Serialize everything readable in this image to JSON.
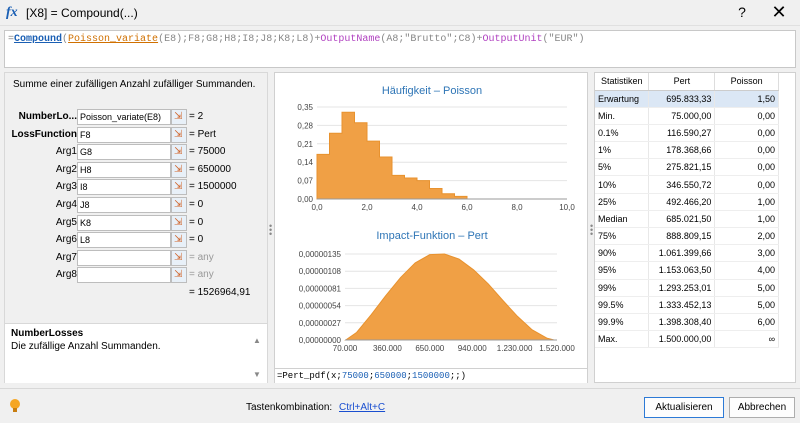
{
  "window": {
    "title": "[X8] = Compound(...)",
    "help": "?",
    "close": "✕"
  },
  "formula": {
    "full": "=Compound(Poisson_variate(E8);F8;G8;H8;I8;J8;K8;L8)+OutputName(A8;\"Brutto\";C8)+OutputUnit(\"EUR\")"
  },
  "left": {
    "summary": "Summe einer zufälligen Anzahl zufälliger Summanden.",
    "args": [
      {
        "label": "NumberLo...",
        "input": "Poisson_variate(E8)",
        "value": "= 2",
        "bold": true
      },
      {
        "label": "LossFunction",
        "input": "F8",
        "value": "= Pert",
        "bold": true
      },
      {
        "label": "Arg1",
        "input": "G8",
        "value": "= 75000"
      },
      {
        "label": "Arg2",
        "input": "H8",
        "value": "= 650000"
      },
      {
        "label": "Arg3",
        "input": "I8",
        "value": "= 1500000"
      },
      {
        "label": "Arg4",
        "input": "J8",
        "value": "= 0"
      },
      {
        "label": "Arg5",
        "input": "K8",
        "value": "= 0"
      },
      {
        "label": "Arg6",
        "input": "L8",
        "value": "= 0"
      },
      {
        "label": "Arg7",
        "input": "",
        "value": "= any",
        "dim": true
      },
      {
        "label": "Arg8",
        "input": "",
        "value": "= any",
        "dim": true
      }
    ],
    "result": "= 1526964,91",
    "desc_title": "NumberLosses",
    "desc_text": "Die zufällige Anzahl Summanden."
  },
  "charts": {
    "pdf_formula": "=Pert_pdf(x;75000;650000;1500000;;)"
  },
  "chart_data": [
    {
      "type": "area",
      "title": "Häufigkeit – Poisson",
      "x": [
        0,
        0.5,
        1.0,
        1.5,
        2.0,
        2.5,
        3.0,
        3.5,
        4.0,
        4.5,
        5.0,
        5.5,
        6.0
      ],
      "y": [
        0.17,
        0.25,
        0.33,
        0.29,
        0.22,
        0.16,
        0.09,
        0.08,
        0.07,
        0.04,
        0.02,
        0.01,
        0.0
      ],
      "xlim": [
        0,
        10
      ],
      "ylim": [
        0,
        0.35
      ],
      "xticks": [
        "0,0",
        "2,0",
        "4,0",
        "6,0",
        "8,0",
        "10,0"
      ],
      "yticks": [
        "0,00",
        "0,07",
        "0,14",
        "0,21",
        "0,28",
        "0,35"
      ],
      "color": "#f0a045"
    },
    {
      "type": "area",
      "title": "Impact-Funktion – Pert",
      "x": [
        75000,
        150000,
        250000,
        350000,
        450000,
        550000,
        650000,
        750000,
        850000,
        950000,
        1050000,
        1150000,
        1250000,
        1350000,
        1450000,
        1500000
      ],
      "y": [
        0,
        1.2e-07,
        4e-07,
        7e-07,
        9.8e-07,
        1.21e-06,
        1.34e-06,
        1.35e-06,
        1.27e-06,
        1.1e-06,
        8.8e-07,
        6.2e-07,
        3.7e-07,
        1.6e-07,
        3e-08,
        0
      ],
      "xlim": [
        70000,
        1520000
      ],
      "ylim": [
        0,
        1.35e-06
      ],
      "xticks": [
        "70.000",
        "360.000",
        "650.000",
        "940.000",
        "1.230.000",
        "1.520.000"
      ],
      "yticks": [
        "0,00000000",
        "0,00000027",
        "0,00000054",
        "0,00000081",
        "0,00000108",
        "0,00000135"
      ],
      "color": "#f0a045"
    }
  ],
  "stats": {
    "headers": [
      "Statistiken",
      "Pert",
      "Poisson"
    ],
    "rows": [
      [
        "Erwartung",
        "695.833,33",
        "1,50"
      ],
      [
        "Min.",
        "75.000,00",
        "0,00"
      ],
      [
        "0.1%",
        "116.590,27",
        "0,00"
      ],
      [
        "1%",
        "178.368,66",
        "0,00"
      ],
      [
        "5%",
        "275.821,15",
        "0,00"
      ],
      [
        "10%",
        "346.550,72",
        "0,00"
      ],
      [
        "25%",
        "492.466,20",
        "1,00"
      ],
      [
        "Median",
        "685.021,50",
        "1,00"
      ],
      [
        "75%",
        "888.809,15",
        "2,00"
      ],
      [
        "90%",
        "1.061.399,66",
        "3,00"
      ],
      [
        "95%",
        "1.153.063,50",
        "4,00"
      ],
      [
        "99%",
        "1.293.253,01",
        "5,00"
      ],
      [
        "99.5%",
        "1.333.452,13",
        "5,00"
      ],
      [
        "99.9%",
        "1.398.308,40",
        "6,00"
      ],
      [
        "Max.",
        "1.500.000,00",
        "∞"
      ]
    ]
  },
  "bottom": {
    "shortcut_label": "Tastenkombination:",
    "shortcut_link": "Ctrl+Alt+C",
    "update_button": "Aktualisieren",
    "cancel_button": "Abbrechen"
  }
}
